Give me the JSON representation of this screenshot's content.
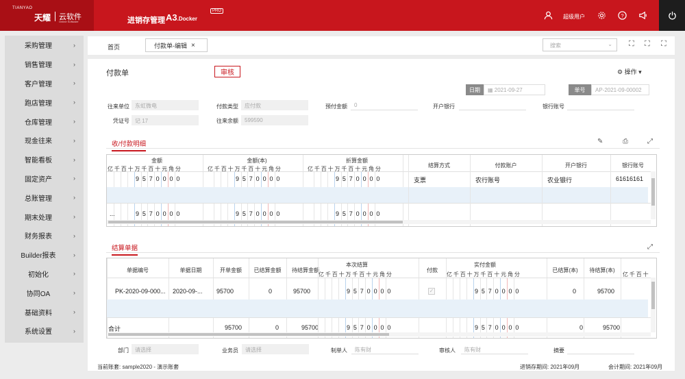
{
  "brand": {
    "small": "TIANYAO",
    "name": "天耀",
    "sub": "云软件",
    "sub2": "Online Software",
    "product": "进销存管理",
    "version_main": "A3",
    "version_sub": ".Docker",
    "pro": "PRO"
  },
  "header": {
    "user": "超级用户",
    "icons": [
      "user-icon",
      "gear-icon",
      "help-icon",
      "announcement-icon",
      "power-icon"
    ]
  },
  "sidebar": {
    "items": [
      {
        "label": "采购管理"
      },
      {
        "label": "销售管理"
      },
      {
        "label": "客户管理"
      },
      {
        "label": "跑店管理"
      },
      {
        "label": "仓库管理"
      },
      {
        "label": "现金往来"
      },
      {
        "label": "智能看板"
      },
      {
        "label": "固定资产"
      },
      {
        "label": "总账管理"
      },
      {
        "label": "期末处理"
      },
      {
        "label": "财务报表"
      },
      {
        "label": "Builder报表"
      },
      {
        "label": "初始化"
      },
      {
        "label": "协同OA"
      },
      {
        "label": "基础资料"
      },
      {
        "label": "系统设置"
      }
    ]
  },
  "tabs": {
    "home": "首页",
    "active": "付款单-编辑"
  },
  "search": {
    "placeholder": "搜索"
  },
  "doc": {
    "title": "付款单",
    "status": "审核",
    "ops": "操作",
    "date_label": "日期",
    "date": "2021-09-27",
    "no_label": "单号",
    "no": "AP-2021-09-00002"
  },
  "fields": {
    "partner_label": "往来单位",
    "partner": "东虹微电",
    "pay_type_label": "付款类型",
    "pay_type": "应付款",
    "prepay_label": "预付金额",
    "prepay": "0",
    "bank_label": "开户银行",
    "account_label": "银行账号",
    "voucher_label": "凭证号",
    "voucher": "记 17",
    "balance_label": "往来余额",
    "balance": "599590"
  },
  "detail": {
    "tab": "收/付款明细",
    "headers": {
      "amount": "金额",
      "amount_base": "金额(本)",
      "discount": "折算金额",
      "method": "结算方式",
      "pay_account": "付款账户",
      "bank": "开户银行",
      "account": "银行账号"
    },
    "digit_units": [
      "亿",
      "千",
      "百",
      "十",
      "万",
      "千",
      "百",
      "十",
      "元",
      "角",
      "分"
    ],
    "rows": [
      {
        "digits": [
          "",
          "",
          "",
          "",
          "9",
          "5",
          "7",
          "0",
          "0",
          "0",
          "0"
        ],
        "method": "支票",
        "pay_account": "农行账号",
        "bank": "农业银行",
        "account": "61616161"
      }
    ],
    "total_label": "...",
    "total_digits": [
      "",
      "",
      "",
      "",
      "9",
      "5",
      "7",
      "0",
      "0",
      "0",
      "0"
    ]
  },
  "settle": {
    "tab": "结算单据",
    "headers": {
      "doc_no": "单据编号",
      "doc_date": "单据日期",
      "open_amount": "开单金额",
      "settled": "已结算金额",
      "pending": "待结算金额",
      "this_settle": "本次结算",
      "pay": "付款",
      "actual_pay": "实付金额",
      "settled_base": "已结算(本)",
      "pending_base": "待结算(本)"
    },
    "digit_units_short": [
      "亿",
      "千",
      "百",
      "十",
      "万",
      "千",
      "百",
      "十",
      "元",
      "角",
      "分"
    ],
    "digit_units_tail": [
      "亿",
      "千",
      "百",
      "十"
    ],
    "rows": [
      {
        "doc_no": "PK-2020-09-000...",
        "doc_date": "2020-09-...",
        "open_amount": "95700",
        "settled": "0",
        "pending": "95700",
        "digits": [
          "",
          "",
          "",
          "",
          "9",
          "5",
          "7",
          "0",
          "0",
          "0",
          "0"
        ],
        "pay": "✓",
        "actual_digits": [
          "",
          "",
          "",
          "",
          "9",
          "5",
          "7",
          "0",
          "0",
          "0",
          "0"
        ],
        "settled_base": "0",
        "pending_base": "95700"
      }
    ],
    "total": {
      "label": "合计",
      "open_amount": "95700",
      "settled": "0",
      "pending": "95700",
      "digits": [
        "",
        "",
        "",
        "",
        "9",
        "5",
        "7",
        "0",
        "0",
        "0",
        "0"
      ],
      "actual_digits": [
        "",
        "",
        "",
        "",
        "9",
        "5",
        "7",
        "0",
        "0",
        "0",
        "0"
      ],
      "settled_base": "0",
      "pending_base": "95700"
    }
  },
  "bottom": {
    "dept_label": "部门",
    "dept": "请选择",
    "staff_label": "业务员",
    "staff": "请选择",
    "maker_label": "制单人",
    "maker": "陈有财",
    "auditor_label": "审核人",
    "auditor": "陈有财",
    "summary_label": "摘要"
  },
  "footer": {
    "book": "当前账套: sample2020 - 演示账套",
    "period": "进销存期间: 2021年09月",
    "acc_period": "会计期间: 2021年09月"
  }
}
